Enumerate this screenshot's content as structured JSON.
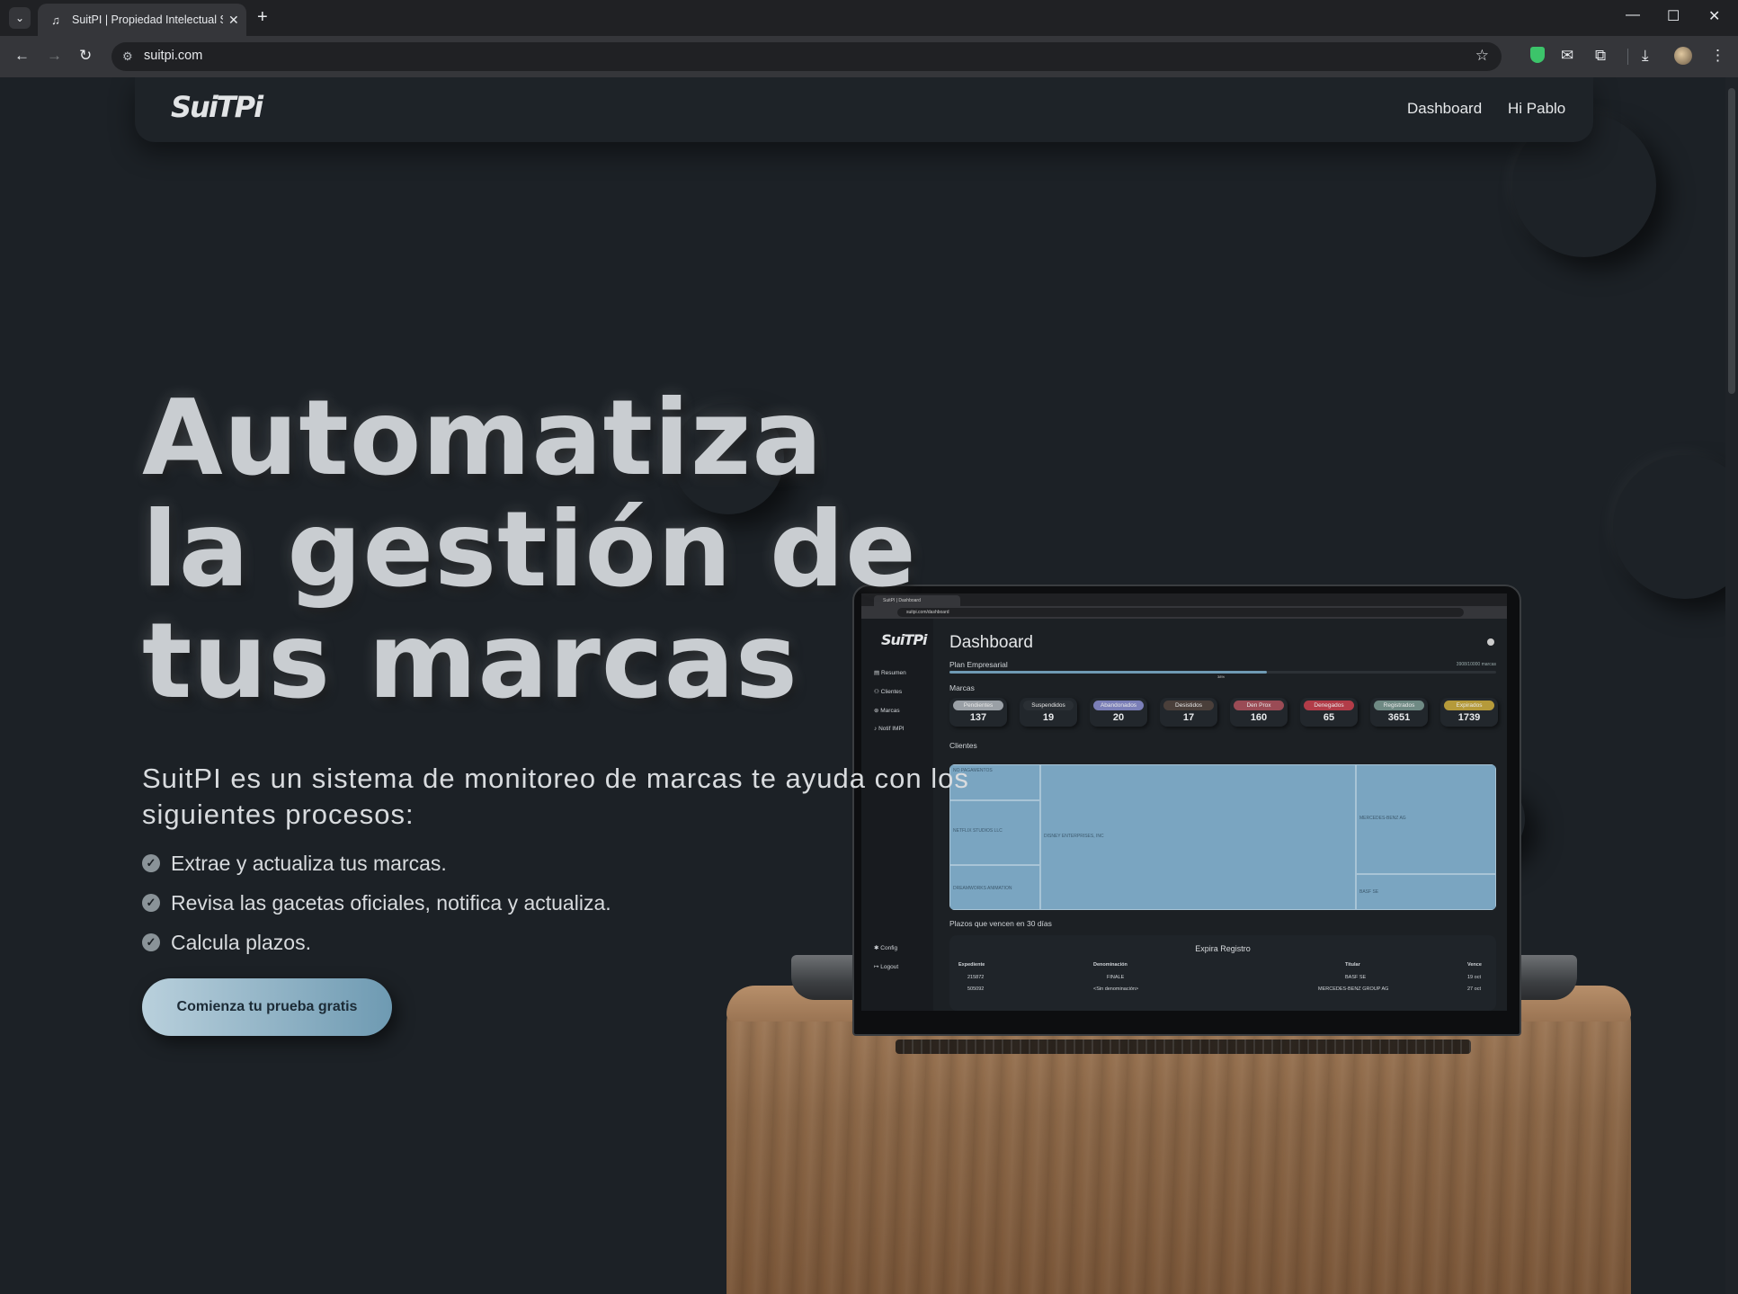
{
  "browser": {
    "tab_title": "SuitPI | Propiedad Intelectual Si",
    "url": "suitpi.com"
  },
  "navbar": {
    "logo": "SuiTPi",
    "links": [
      "Dashboard",
      "Hi Pablo"
    ]
  },
  "hero": {
    "title": "Automatiza la gestión de tus marcas",
    "subtitle": "SuitPI es un sistema de monitoreo de marcas te ayuda con los siguientes procesos:",
    "features": [
      "Extrae y actualiza tus marcas.",
      "Revisa las gacetas oficiales, notifica y actualiza.",
      "Calcula plazos."
    ],
    "cta": "Comienza tu prueba gratis"
  },
  "colors": {
    "background": "#1c2126",
    "accent": "#7aa5c1",
    "check": "#8a9398"
  },
  "laptop_screen": {
    "tab_title": "SuitPI | Dashboard",
    "url": "suitpi.com/dashboard",
    "logo": "SuiTPi",
    "sidebar": [
      "Resumen",
      "Clientes",
      "Marcas",
      "Notif IMPI"
    ],
    "sidebar_footer": [
      "Config",
      "Logout"
    ],
    "title": "Dashboard",
    "plan": "Plan Empresarial",
    "plan_count": "3908/10000 marcas",
    "plan_progress_pct": "38%",
    "plan_progress": 0.58,
    "section_marcas": "Marcas",
    "stats": [
      {
        "label": "Pendientes",
        "value": "137",
        "color": "#9aa0a6"
      },
      {
        "label": "Suspendidos",
        "value": "19",
        "color": "#2a2f34"
      },
      {
        "label": "Abandonados",
        "value": "20",
        "color": "#7b7fb8"
      },
      {
        "label": "Desistidos",
        "value": "17",
        "color": "#4a3f3a"
      },
      {
        "label": "Den Prox",
        "value": "160",
        "color": "#9a4b55"
      },
      {
        "label": "Denegados",
        "value": "65",
        "color": "#b23c48"
      },
      {
        "label": "Registrados",
        "value": "3651",
        "color": "#6f8a84"
      },
      {
        "label": "Expirados",
        "value": "1739",
        "color": "#b59a3a"
      }
    ],
    "section_clientes": "Clientes",
    "treemap": [
      "NO PAGAMENTOS",
      "NETFLIX STUDIOS LLC",
      "DREAMWORKS ANIMATION",
      "DISNEY ENTERPRISES, INC",
      "MERCEDES-BENZ AG",
      "BASF SE"
    ],
    "section_plazos": "Plazos que vencen en 30 días",
    "table": {
      "title": "Expira Registro",
      "headers": [
        "Expediente",
        "Denominación",
        "Titular",
        "Vence"
      ],
      "rows": [
        [
          "215872",
          "FINALE",
          "BASF SE",
          "19 oct"
        ],
        [
          "505092",
          "<Sin denominación>",
          "MERCEDES-BENZ GROUP AG",
          "27 oct"
        ]
      ]
    }
  }
}
